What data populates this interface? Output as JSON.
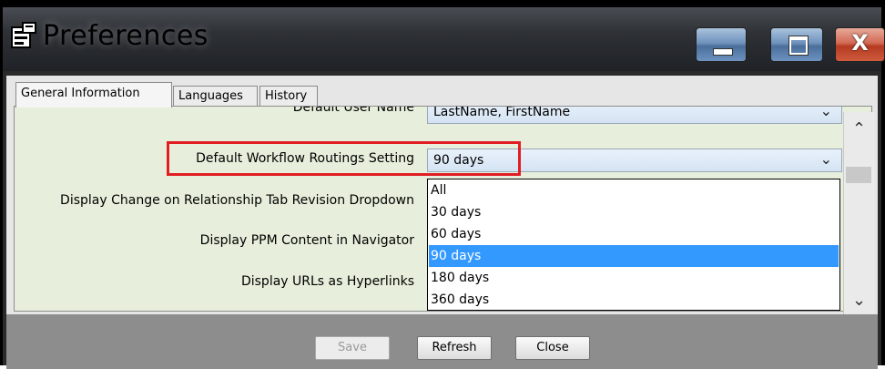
{
  "window": {
    "title": "Preferences",
    "buttons": [
      "minimize",
      "maximize",
      "close"
    ],
    "close_glyph": "X"
  },
  "tabs": [
    {
      "label": "General Information",
      "active": true
    },
    {
      "label": "Languages",
      "active": false
    },
    {
      "label": "History",
      "active": false
    }
  ],
  "fields": {
    "default_user_name_label": "Default User Name",
    "default_user_name_value": "LastName, FirstName",
    "workflow_label": "Default Workflow Routings Setting",
    "workflow_value": "90 days",
    "relationship_label": "Display Change on Relationship Tab Revision Dropdown",
    "ppm_label": "Display PPM Content in Navigator",
    "urls_label": "Display URLs as Hyperlinks"
  },
  "dropdown": {
    "options": [
      "All",
      "30 days",
      "60 days",
      "90 days",
      "180 days",
      "360 days"
    ],
    "selected": "90 days"
  },
  "buttons": {
    "save": "Save",
    "refresh": "Refresh",
    "close": "Close"
  },
  "colors": {
    "highlight_border": "#e11d24",
    "selected_option": "#3399ff",
    "panel_background": "#e7efdc"
  }
}
